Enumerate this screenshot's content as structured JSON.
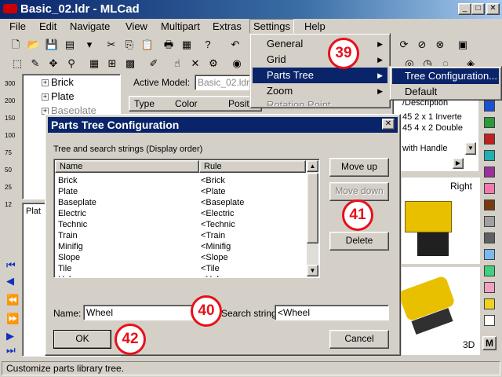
{
  "window": {
    "title": "Basic_02.ldr - MLCad"
  },
  "menubar": {
    "items": [
      "File",
      "Edit",
      "Navigate",
      "View",
      "Multipart",
      "Extras",
      "Settings",
      "Help"
    ]
  },
  "settings_menu": {
    "items": [
      "General",
      "Grid",
      "Parts Tree",
      "Zoom",
      "Rotation Point"
    ]
  },
  "parts_tree_submenu": {
    "items": [
      "Tree Configuration...",
      "Default"
    ]
  },
  "badges": {
    "b39": "39",
    "b40": "40",
    "b41": "41",
    "b42": "42"
  },
  "tree": {
    "items": [
      "Brick",
      "Plate",
      "Baseplate"
    ]
  },
  "active_model": {
    "label": "Active Model:",
    "value": "Basic_02.ldr"
  },
  "model_columns": {
    "type": "Type",
    "color": "Color",
    "position": "Positi"
  },
  "parts_list": {
    "header": "/Description",
    "rows": [
      "45  2 x 1 Inverte",
      "45  4 x 2 Double",
      "with Handle"
    ]
  },
  "preview_labels": {
    "right": "Right",
    "threed": "3D"
  },
  "left_preview_label": "Plat",
  "dialog": {
    "title": "Parts Tree Configuration",
    "caption": "Tree and search strings (Display order)",
    "columns": {
      "name": "Name",
      "rule": "Rule"
    },
    "rows": [
      {
        "name": "Brick",
        "rule": "<Brick"
      },
      {
        "name": "Plate",
        "rule": "<Plate"
      },
      {
        "name": "Baseplate",
        "rule": "<Baseplate"
      },
      {
        "name": "Electric",
        "rule": "<Electric"
      },
      {
        "name": "Technic",
        "rule": "<Technic"
      },
      {
        "name": "Train",
        "rule": "<Train"
      },
      {
        "name": "Minifig",
        "rule": "<Minifig"
      },
      {
        "name": "Slope",
        "rule": "<Slope"
      },
      {
        "name": "Tile",
        "rule": "<Tile"
      },
      {
        "name": "Helper",
        "rule": "<Helper"
      }
    ],
    "buttons": {
      "move_up": "Move up",
      "move_down": "Move down",
      "delete": "Delete",
      "ok": "OK",
      "cancel": "Cancel"
    },
    "name_label": "Name:",
    "name_value": "Wheel",
    "search_label": "Search string:",
    "search_value": "<Wheel"
  },
  "zoom_labels": [
    "300",
    "200",
    "150",
    "100",
    "75",
    "50",
    "25",
    "12"
  ],
  "statusbar": {
    "text": "Customize parts library tree."
  },
  "palette": [
    "#1a4fd8",
    "#2a9a3a",
    "#c02020",
    "#20b0b0",
    "#9a30a0",
    "#f07ab0",
    "#7a3a10",
    "#a0a0a0",
    "#606060",
    "#7ab8f0",
    "#40d080",
    "#f0a0c0",
    "#f0d020",
    "#ffffff"
  ],
  "accent": {
    "titlebar": "#0a246a",
    "badge": "#e8101a"
  }
}
